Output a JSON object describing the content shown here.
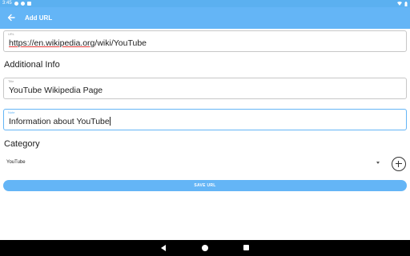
{
  "status_bar": {
    "time": "3:45",
    "left_icons": [
      "gmail-icon",
      "cloud-icon",
      "sim-icon"
    ],
    "right_icons": [
      "wifi-icon",
      "battery-icon"
    ]
  },
  "app_bar": {
    "title": "Add URL",
    "back_icon": "arrow-back-icon",
    "color": "#64b5f6"
  },
  "url_field": {
    "label": "URL",
    "value_parts": [
      "https://",
      "en.wikipedia.org",
      "/wiki/YouTube"
    ]
  },
  "additional_info_heading": "Additional Info",
  "title_field": {
    "label": "Title",
    "value": "YouTube Wikipedia Page"
  },
  "note_field": {
    "label": "Note",
    "value": "Information about YouTube"
  },
  "category_heading": "Category",
  "category_dropdown": {
    "selected": "YouTube"
  },
  "add_category_icon": "add-circle-icon",
  "save_button": {
    "label": "SAVE URL"
  },
  "nav_bar": {
    "icons": [
      "back-icon",
      "home-icon",
      "recents-icon"
    ]
  }
}
